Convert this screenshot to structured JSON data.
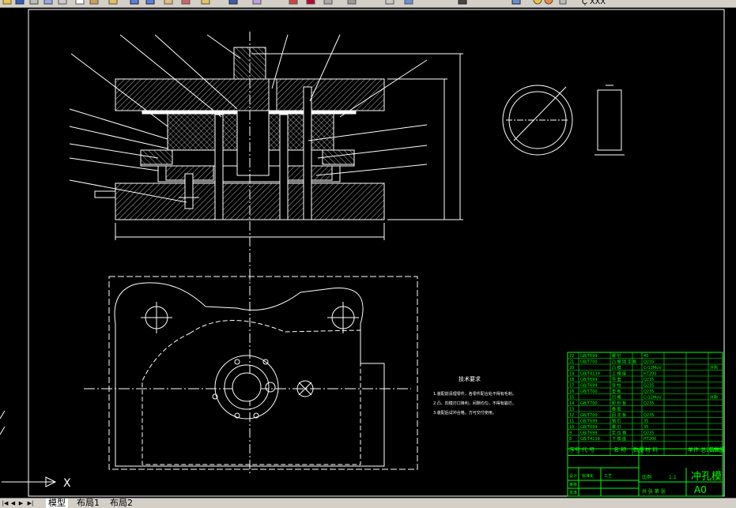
{
  "window": {
    "title_fragment": "Ç XXX",
    "colors": {
      "canvas": "#000000",
      "lines": "#ffffff",
      "table": "#00ff00",
      "ui": "#d4d0c8"
    }
  },
  "toolbar": {
    "icons": [
      "open-icon",
      "save-icon",
      "print-icon",
      "preview-icon",
      "cut-icon",
      "copy-icon",
      "paste-icon",
      "match-icon",
      "undo-icon",
      "redo-icon",
      "pan-icon",
      "zoom-realtime-icon",
      "zoom-window-icon",
      "zoom-previous-icon",
      "properties-icon",
      "design-center-icon",
      "tool-palette-icon",
      "sheet-set-icon",
      "markup-icon",
      "calc-icon",
      "help-icon",
      "layer-icon",
      "color-icon"
    ]
  },
  "tabs": {
    "nav": [
      "|◀",
      "◀",
      "▶",
      "▶|"
    ],
    "items": [
      {
        "label": "模型",
        "active": true
      },
      {
        "label": "布局1",
        "active": false
      },
      {
        "label": "布局2",
        "active": false
      }
    ]
  },
  "drawing": {
    "title": "冲孔模",
    "sheet_size": "A0",
    "tech_req_title": "技术要求",
    "tech_req_lines": [
      "1.装配前清理零件，各零件配合处不得有毛刺。",
      "2.凸、凹模刃口锋利，间隙均匀，不得有崩刃。",
      "3.装配后试冲合格，方可交付使用。"
    ],
    "bom_rows": [
      {
        "no": "22",
        "std": "GB/T699",
        "name": "螺 钉",
        "mat": "45",
        "note": ""
      },
      {
        "no": "21",
        "std": "GB/T700",
        "name": "凸 模 固 定 板",
        "mat": "Q235",
        "note": ""
      },
      {
        "no": "20",
        "std": "",
        "name": "凸 模",
        "mat": "Cr12MoV",
        "note": "外购"
      },
      {
        "no": "19",
        "std": "GB/T4139",
        "name": "上 模 座",
        "mat": "HT200",
        "note": ""
      },
      {
        "no": "18",
        "std": "GB/T699",
        "name": "导 套",
        "mat": "Q235",
        "note": ""
      },
      {
        "no": "17",
        "std": "GB/T699",
        "name": "导 柱",
        "mat": "Q235",
        "note": ""
      },
      {
        "no": "16",
        "std": "GB/T700",
        "name": "垫 板",
        "mat": "Q235",
        "note": ""
      },
      {
        "no": "15",
        "std": "",
        "name": "凹 模",
        "mat": "Cr12MoV",
        "note": "外购"
      },
      {
        "no": "14",
        "std": "GB/T700",
        "name": "卸 料 板",
        "mat": "Q235",
        "note": ""
      },
      {
        "no": "13",
        "std": "",
        "name": "橡 胶",
        "mat": "",
        "note": ""
      },
      {
        "no": "12",
        "std": "GB/T700",
        "name": "固 定 板",
        "mat": "Q235",
        "note": ""
      },
      {
        "no": "11",
        "std": "GB/T699",
        "name": "销 钉",
        "mat": "35",
        "note": ""
      },
      {
        "no": "10",
        "std": "GB/T699",
        "name": "螺 钉",
        "mat": "35",
        "note": ""
      },
      {
        "no": "9",
        "std": "GB/T699",
        "name": "定 位 销",
        "mat": "Q235",
        "note": ""
      },
      {
        "no": "8",
        "std": "GB/T4139",
        "name": "下 模 座",
        "mat": "HT200",
        "note": ""
      }
    ],
    "bom_header": {
      "no": "序号",
      "code": "代 号",
      "name": "名 称",
      "qty": "数量",
      "mat": "材 料",
      "weight": "单件 总计 重量",
      "note": "备注"
    },
    "title_block": {
      "scale_label": "比例",
      "scale": "1:1",
      "sheet_label": "共 张 第 张",
      "designer": "设计",
      "checker": "审核",
      "standard": "标准化",
      "approve": "批准",
      "craft": "工艺"
    }
  }
}
